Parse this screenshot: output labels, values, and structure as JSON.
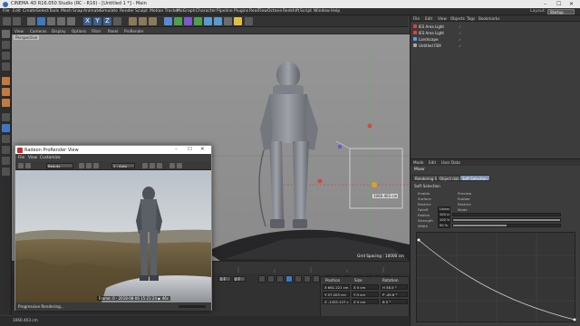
{
  "app": {
    "title": "CINEMA 4D R16.050 Studio (RC - R16) - [Untitled 1 *] - Main",
    "layout_label": "Layout:",
    "layout_value": "Startup"
  },
  "menubar": [
    "File",
    "Edit",
    "Create",
    "Select",
    "Tools",
    "Mesh",
    "Snap",
    "Animate",
    "Simulate",
    "Render",
    "Sculpt",
    "Motion Tracker",
    "MoGraph",
    "Character",
    "Pipeline",
    "Plugins",
    "RealFlow",
    "Octane",
    "Redshift",
    "Script",
    "Window",
    "Help"
  ],
  "viewport": {
    "menu": [
      "View",
      "Cameras",
      "Display",
      "Options",
      "Filter",
      "Panel",
      "ProRender"
    ],
    "label": "Perspective",
    "grid_spacing": "Grid Spacing : 10000 cm",
    "dimension_readout": "1060.403 cm"
  },
  "object_manager": {
    "menu": [
      "File",
      "Edit",
      "View",
      "Objects",
      "Tags",
      "Bookmarks"
    ],
    "objects": [
      {
        "name": "IES Area Light",
        "color": "#e04040"
      },
      {
        "name": "IES Area Light",
        "color": "#e04040"
      },
      {
        "name": "Landscape",
        "color": "#4ea3ff"
      },
      {
        "name": "Untitled FBX",
        "color": "#aaaaaa"
      }
    ]
  },
  "attribute_manager": {
    "menu": [
      "Mode",
      "Edit",
      "User Data"
    ],
    "object_name": "Mixer",
    "tabs": [
      "Rendering Setting",
      "Object data",
      "Soft Selection"
    ],
    "active_tab": "Soft Selection",
    "section": "Soft Selection",
    "props": [
      {
        "label": "Enable",
        "value": "",
        "label2": "Preview"
      },
      {
        "label": "Surface",
        "value": "",
        "label2": "Rubber"
      },
      {
        "label": "Restrict",
        "value": "",
        "label2": "Restrict"
      },
      {
        "label": "Falloff",
        "value": "Linear",
        "label2": "Mode"
      },
      {
        "label": "Radius",
        "value": "100 cm",
        "fill": 0.0
      },
      {
        "label": "Strength",
        "value": "100 %",
        "fill": 1.0
      },
      {
        "label": "Width",
        "value": "50 %",
        "fill": 0.5
      }
    ]
  },
  "timeline": {
    "start_frame": "0 F",
    "current_frame": "0 F",
    "end_frame": "90 F",
    "end_frame2": "90 F"
  },
  "coordinates": {
    "headers": [
      "Position",
      "Size",
      "Rotation"
    ],
    "rows": [
      [
        "X 661.221 cm",
        "X 0 cm",
        "H 38.5 °"
      ],
      [
        "Y 57.203 cm",
        "Y 0 cm",
        "P -45.6 °"
      ],
      [
        "Z -1325.127 cm",
        "Z 0 cm",
        "B 0 °"
      ]
    ],
    "mode": "Object (Rel)",
    "size_mode": "Size",
    "apply": "Apply"
  },
  "render_window": {
    "title": "Radeon ProRender View",
    "menu": [
      "File",
      "View",
      "Customize"
    ],
    "toolbar_select": "Beauty",
    "toolbar_select2": "1 : Auto",
    "frame_caption": "Frame: 0 - 2018-08-06 15:21:24 ▶ 46s",
    "status": "Progressive Rendering..."
  },
  "status_bar": "1060.403 cm"
}
